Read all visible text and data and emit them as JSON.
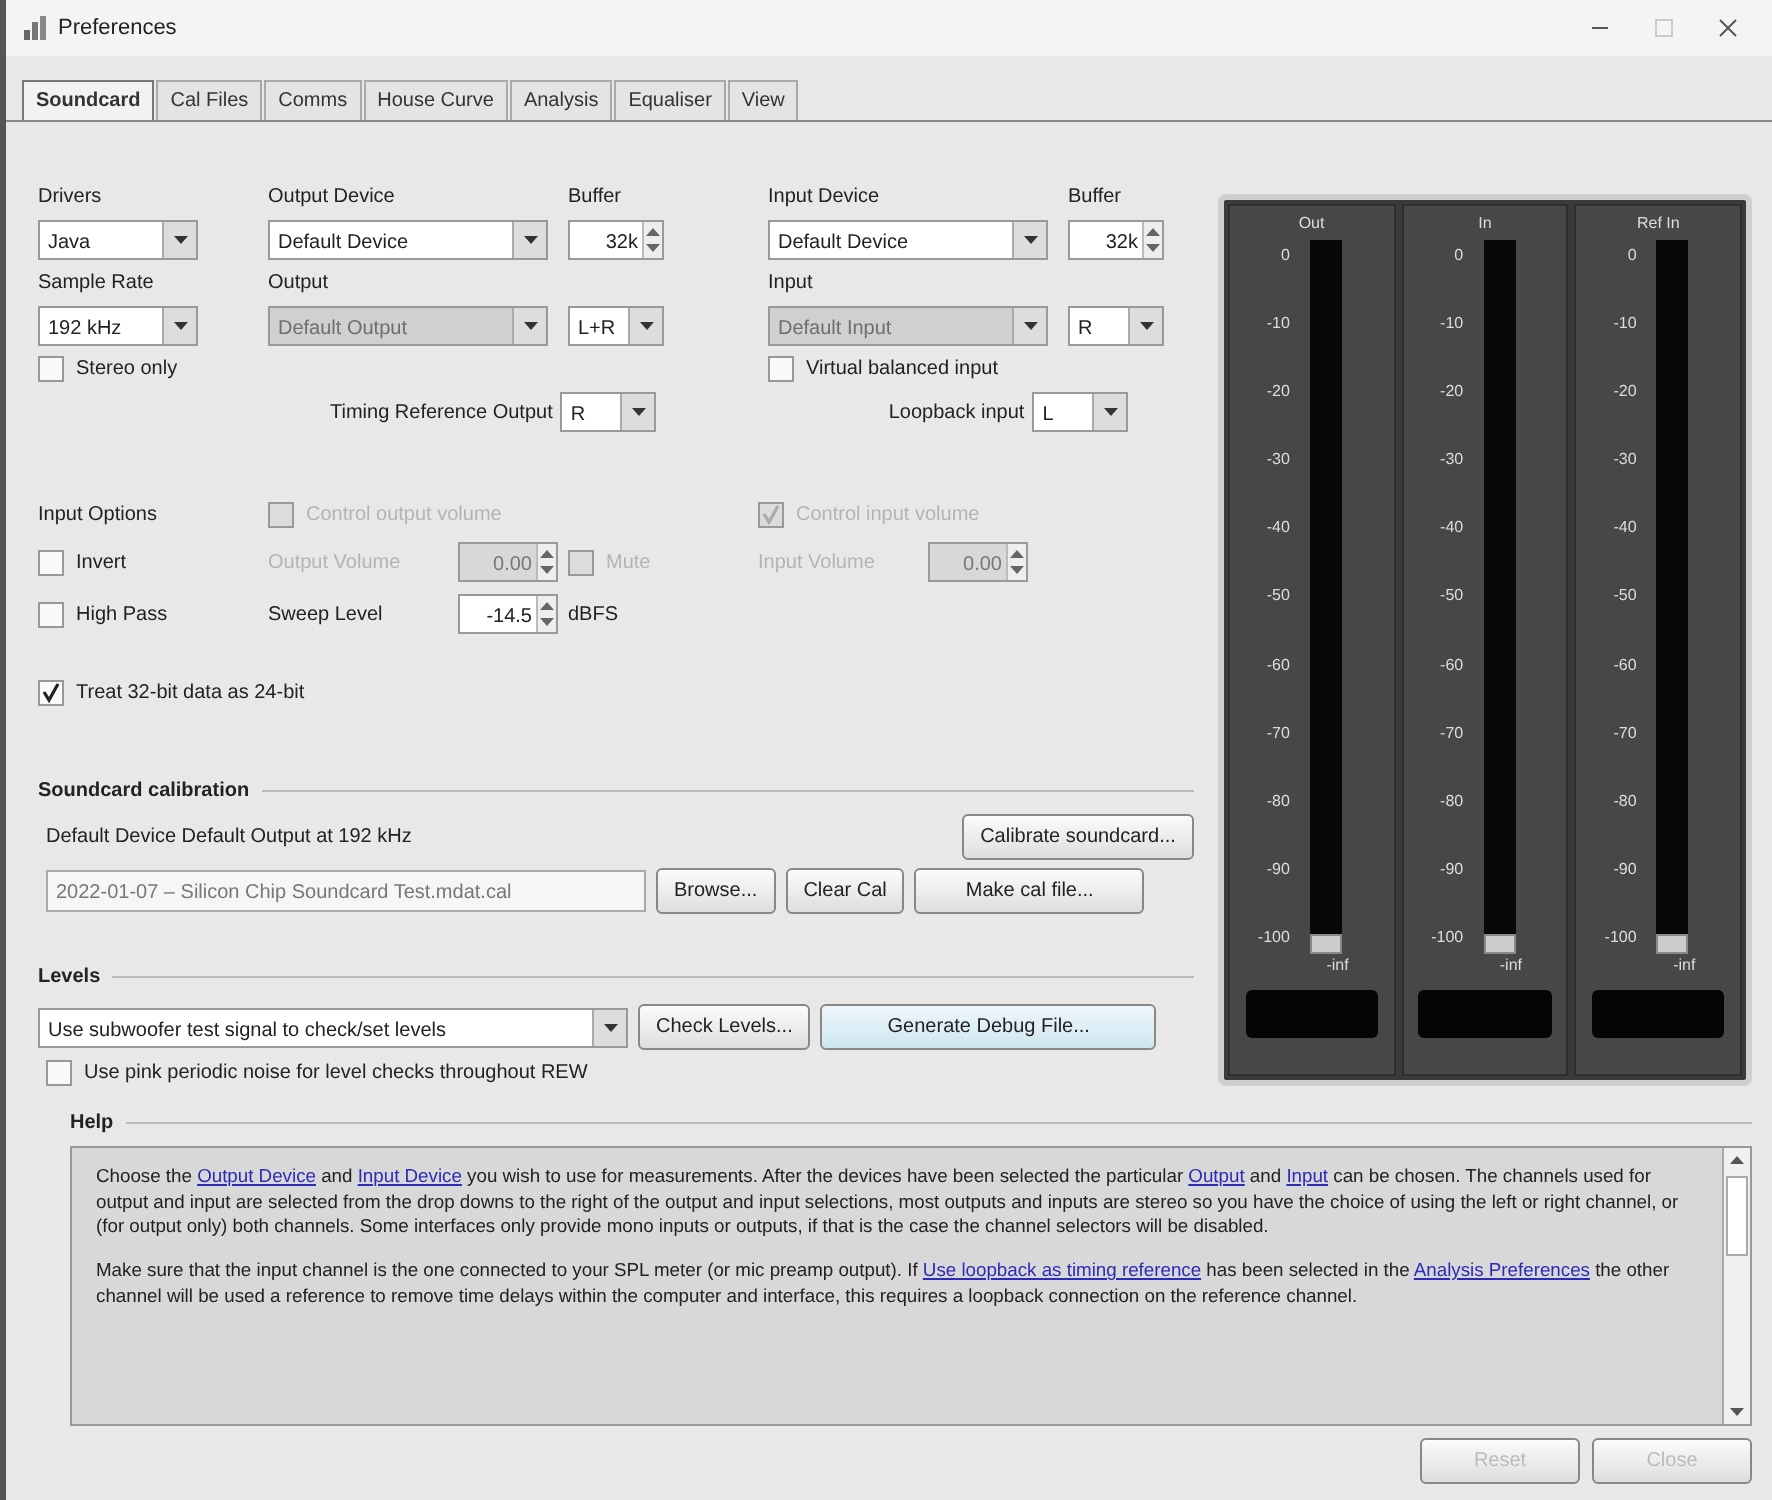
{
  "window": {
    "title": "Preferences"
  },
  "tabs": [
    {
      "label": "Soundcard",
      "selected": true
    },
    {
      "label": "Cal Files",
      "selected": false
    },
    {
      "label": "Comms",
      "selected": false
    },
    {
      "label": "House Curve",
      "selected": false
    },
    {
      "label": "Analysis",
      "selected": false
    },
    {
      "label": "Equaliser",
      "selected": false
    },
    {
      "label": "View",
      "selected": false
    }
  ],
  "drivers": {
    "label": "Drivers",
    "value": "Java"
  },
  "sample_rate": {
    "label": "Sample Rate",
    "value": "192 kHz"
  },
  "stereo_only": {
    "label": "Stereo only",
    "checked": false
  },
  "output_device": {
    "label": "Output Device",
    "value": "Default Device"
  },
  "output_buffer": {
    "label": "Buffer",
    "value": "32k"
  },
  "output": {
    "label": "Output",
    "value": "Default Output",
    "disabled": true
  },
  "output_channel": {
    "value": "L+R"
  },
  "timing_reference_output": {
    "label": "Timing Reference Output",
    "value": "R"
  },
  "input_device": {
    "label": "Input Device",
    "value": "Default Device"
  },
  "input_buffer": {
    "label": "Buffer",
    "value": "32k"
  },
  "input": {
    "label": "Input",
    "value": "Default Input",
    "disabled": true
  },
  "input_channel": {
    "value": "R"
  },
  "virtual_balanced_input": {
    "label": "Virtual balanced input",
    "checked": false
  },
  "loopback_input": {
    "label": "Loopback input",
    "value": "L"
  },
  "input_options": {
    "label": "Input Options",
    "items": [
      {
        "label": "Invert",
        "checked": false
      },
      {
        "label": "High Pass",
        "checked": false
      }
    ]
  },
  "control_output_volume": {
    "label": "Control output volume",
    "checked": false,
    "disabled": true
  },
  "output_volume": {
    "label": "Output Volume",
    "value": "0.00",
    "disabled": true
  },
  "mute": {
    "label": "Mute",
    "checked": false,
    "disabled": true
  },
  "sweep_level": {
    "label": "Sweep Level",
    "value": "-14.5",
    "unit": "dBFS"
  },
  "control_input_volume": {
    "label": "Control input volume",
    "checked": true,
    "disabled": true
  },
  "input_volume": {
    "label": "Input Volume",
    "value": "0.00",
    "disabled": true
  },
  "treat_32bit": {
    "label": "Treat 32-bit data as 24-bit",
    "checked": true
  },
  "calibration": {
    "title": "Soundcard calibration",
    "description": "Default Device Default Output at 192 kHz",
    "file": "2022-01-07 – Silicon Chip Soundcard Test.mdat.cal",
    "calibrate_button": "Calibrate soundcard...",
    "browse_button": "Browse...",
    "clear_button": "Clear Cal",
    "make_button": "Make cal file..."
  },
  "levels": {
    "title": "Levels",
    "signal": "Use subwoofer test signal to check/set levels",
    "check_button": "Check Levels...",
    "debug_button": "Generate Debug File...",
    "pink_noise": {
      "label": "Use pink periodic noise for level checks throughout REW",
      "checked": false
    }
  },
  "meters": [
    {
      "label": "Out",
      "scale": [
        "0",
        "-10",
        "-20",
        "-30",
        "-40",
        "-50",
        "-60",
        "-70",
        "-80",
        "-90",
        "-100"
      ],
      "level": 0,
      "reading": "-inf"
    },
    {
      "label": "In",
      "scale": [
        "0",
        "-10",
        "-20",
        "-30",
        "-40",
        "-50",
        "-60",
        "-70",
        "-80",
        "-90",
        "-100"
      ],
      "level": 0,
      "reading": "-inf"
    },
    {
      "label": "Ref In",
      "scale": [
        "0",
        "-10",
        "-20",
        "-30",
        "-40",
        "-50",
        "-60",
        "-70",
        "-80",
        "-90",
        "-100"
      ],
      "level": 0,
      "reading": "-inf"
    }
  ],
  "help": {
    "title": "Help",
    "paragraphs": [
      [
        {
          "kind": "text",
          "text": "Choose the "
        },
        {
          "kind": "link",
          "text": "Output Device"
        },
        {
          "kind": "text",
          "text": " and "
        },
        {
          "kind": "link",
          "text": "Input Device"
        },
        {
          "kind": "text",
          "text": " you wish to use for measurements. After the devices have been selected the particular "
        },
        {
          "kind": "link",
          "text": "Output"
        },
        {
          "kind": "text",
          "text": " and "
        },
        {
          "kind": "link",
          "text": "Input"
        },
        {
          "kind": "text",
          "text": " can be chosen. The channels used for output and input are selected from the drop downs to the right of the output and input selections, most outputs and inputs are stereo so you have the choice of using the left or right channel, or (for output only) both channels. Some interfaces only provide mono inputs or outputs, if that is the case the channel selectors will be disabled."
        }
      ],
      [
        {
          "kind": "text",
          "text": "Make sure that the input channel is the one connected to your SPL meter (or mic preamp output). If "
        },
        {
          "kind": "link",
          "text": "Use loopback as timing reference"
        },
        {
          "kind": "text",
          "text": " has been selected in the "
        },
        {
          "kind": "link",
          "text": "Analysis Preferences"
        },
        {
          "kind": "text",
          "text": " the other channel will be used a reference to remove time delays within the computer and interface, this requires a loopback connection on the reference channel."
        }
      ]
    ]
  },
  "buttons": [
    {
      "label": "Reset",
      "disabled": true
    },
    {
      "label": "Close",
      "disabled": true
    }
  ]
}
